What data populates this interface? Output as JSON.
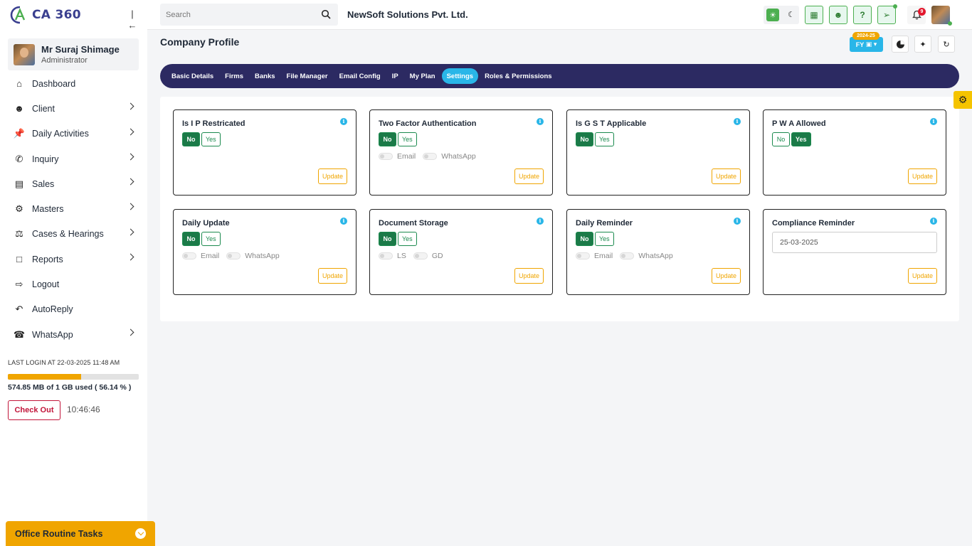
{
  "app": {
    "logo_text": "CA 360",
    "company_name": "NewSoft Solutions Pvt. Ltd."
  },
  "user": {
    "name": "Mr Suraj Shimage",
    "role": "Administrator"
  },
  "search": {
    "placeholder": "Search"
  },
  "notifications": {
    "count": "9"
  },
  "nav": [
    {
      "label": "Dashboard",
      "icon": "home-icon",
      "chevron": false
    },
    {
      "label": "Client",
      "icon": "users-icon",
      "chevron": true
    },
    {
      "label": "Daily Activities",
      "icon": "pin-icon",
      "chevron": true
    },
    {
      "label": "Inquiry",
      "icon": "phone-icon",
      "chevron": true
    },
    {
      "label": "Sales",
      "icon": "money-icon",
      "chevron": true
    },
    {
      "label": "Masters",
      "icon": "gears-icon",
      "chevron": true
    },
    {
      "label": "Cases & Hearings",
      "icon": "scales-icon",
      "chevron": true
    },
    {
      "label": "Reports",
      "icon": "report-icon",
      "chevron": true
    },
    {
      "label": "Logout",
      "icon": "logout-icon",
      "chevron": false
    },
    {
      "label": "AutoReply",
      "icon": "reply-icon",
      "chevron": false
    },
    {
      "label": "WhatsApp",
      "icon": "whatsapp-icon",
      "chevron": true
    }
  ],
  "sidebar_footer": {
    "last_login": "LAST LOGIN AT 22-03-2025 11:48 AM",
    "storage_text": "574.85 MB of 1 GB used ( 56.14 % )",
    "storage_percent": 56.14,
    "checkout_label": "Check Out",
    "clock": "10:46:46"
  },
  "routine": {
    "label": "Office Routine Tasks"
  },
  "page": {
    "title": "Company Profile",
    "fy_label": "FY",
    "fy_year": "2024-25"
  },
  "tabs": [
    {
      "label": "Basic Details",
      "active": false
    },
    {
      "label": "Firms",
      "active": false
    },
    {
      "label": "Banks",
      "active": false
    },
    {
      "label": "File Manager",
      "active": false
    },
    {
      "label": "Email Config",
      "active": false
    },
    {
      "label": "IP",
      "active": false
    },
    {
      "label": "My Plan",
      "active": false
    },
    {
      "label": "Settings",
      "active": true
    },
    {
      "label": "Roles & Permissions",
      "active": false
    }
  ],
  "cards": [
    {
      "title": "Is I P Restricated",
      "selected": "No",
      "switches": []
    },
    {
      "title": "Two Factor Authentication",
      "selected": "No",
      "switches": [
        "Email",
        "WhatsApp"
      ]
    },
    {
      "title": "Is G S T Applicable",
      "selected": "No",
      "switches": []
    },
    {
      "title": "P W A Allowed",
      "selected": "Yes",
      "switches": []
    },
    {
      "title": "Daily Update",
      "selected": "No",
      "switches": [
        "Email",
        "WhatsApp"
      ]
    },
    {
      "title": "Document Storage",
      "selected": "No",
      "switches": [
        "LS",
        "GD"
      ]
    },
    {
      "title": "Daily Reminder",
      "selected": "No",
      "switches": [
        "Email",
        "WhatsApp"
      ]
    },
    {
      "title": "Compliance Reminder",
      "date": "25-03-2025"
    }
  ],
  "labels": {
    "no": "No",
    "yes": "Yes",
    "update": "Update",
    "info": "i"
  },
  "colors": {
    "primary_nav": "#2c2a62",
    "accent": "#29b6e8",
    "success": "#1b7a48",
    "warning": "#f0a500",
    "danger": "#c2153a"
  }
}
